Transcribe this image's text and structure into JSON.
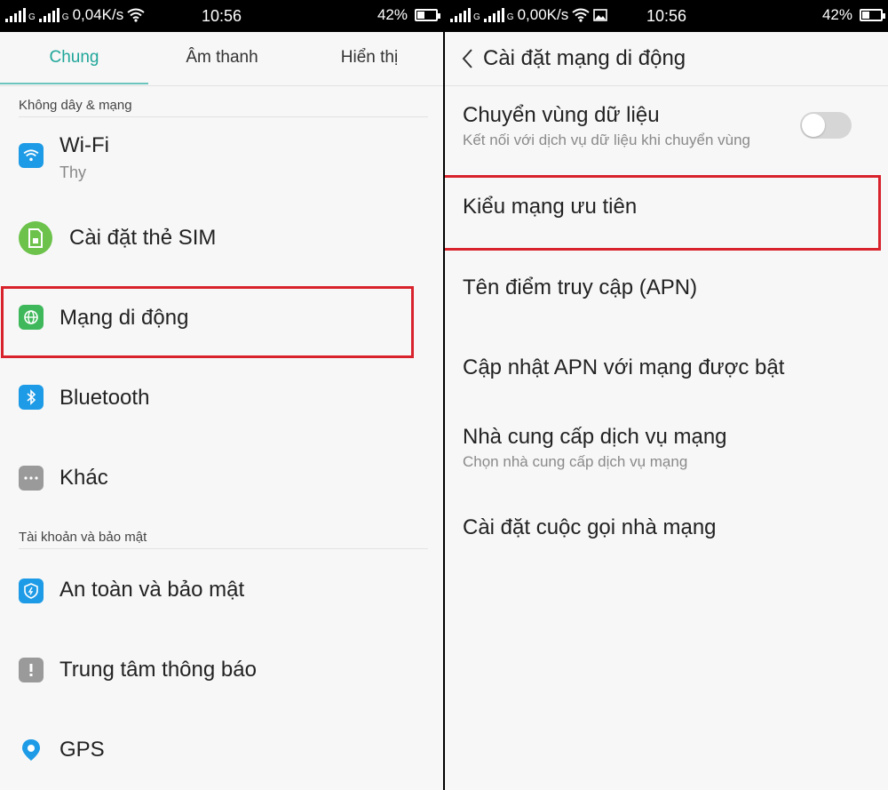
{
  "left_screen": {
    "status_bar": {
      "speed": "0,04K/s",
      "time": "10:56",
      "battery": "42%",
      "battery_level": 0.42
    },
    "tabs": [
      {
        "label": "Chung",
        "active": true
      },
      {
        "label": "Âm thanh",
        "active": false
      },
      {
        "label": "Hiển thị",
        "active": false
      }
    ],
    "sections": [
      {
        "header": "Không dây & mạng"
      },
      {
        "header": "Tài khoản và bảo mật"
      }
    ],
    "items": [
      {
        "title": "Wi-Fi",
        "subtitle": "Thy",
        "icon": "wifi-icon",
        "color": "#1e9be6"
      },
      {
        "title": "Cài đặt thẻ SIM",
        "icon": "sim-card-icon",
        "color": "#6cc24a"
      },
      {
        "title": "Mạng di động",
        "icon": "globe-icon",
        "color": "#3fb85b",
        "highlighted": true
      },
      {
        "title": "Bluetooth",
        "icon": "bluetooth-icon",
        "color": "#1e9be6"
      },
      {
        "title": "Khác",
        "icon": "more-dots-icon",
        "color": "#9a9a9a"
      },
      {
        "title": "An toàn và bảo mật",
        "icon": "security-shield-icon",
        "color": "#1e9be6"
      },
      {
        "title": "Trung tâm thông báo",
        "icon": "notification-exclamation-icon",
        "color": "#9a9a9a"
      },
      {
        "title": "GPS",
        "icon": "location-pin-icon",
        "color": "#1e9be6"
      }
    ]
  },
  "right_screen": {
    "status_bar": {
      "speed": "0,00K/s",
      "time": "10:56",
      "battery": "42%",
      "battery_level": 0.42
    },
    "header": {
      "title": "Cài đặt mạng di động",
      "back_icon": "chevron-left-icon"
    },
    "items": [
      {
        "title": "Chuyển vùng dữ liệu",
        "subtitle": "Kết nối với dịch vụ dữ liệu khi chuyển vùng",
        "toggle": false
      },
      {
        "title": "Kiểu mạng ưu tiên",
        "highlighted": true
      },
      {
        "title": "Tên điểm truy cập (APN)"
      },
      {
        "title": "Cập nhật APN với mạng được bật"
      },
      {
        "title": "Nhà cung cấp dịch vụ mạng",
        "subtitle": "Chọn nhà cung cấp dịch vụ mạng"
      },
      {
        "title": "Cài đặt cuộc gọi nhà mạng"
      }
    ]
  },
  "colors": {
    "accent": "#20a69a",
    "highlight": "#d9232c"
  }
}
